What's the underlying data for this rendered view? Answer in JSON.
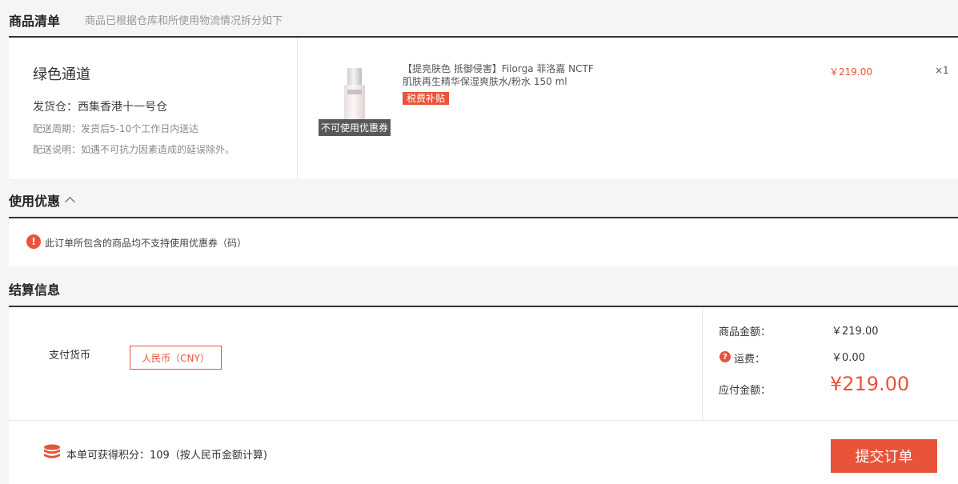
{
  "items_section": {
    "title": "商品清单",
    "subtitle": "商品已根据仓库和所使用物流情况拆分如下"
  },
  "shipment": {
    "channel": "绿色通道",
    "warehouse": "发货仓：西集香港十一号仓",
    "delivery_period": "配送周期：发货后5-10个工作日内送达",
    "delivery_note": "配送说明：如遇不可抗力因素造成的延误除外。"
  },
  "product": {
    "name_line1": "【提亮肤色 抵御侵害】Filorga 菲洛嘉 NCTF",
    "name_line2": "肌肤再生精华保湿爽肤水/粉水 150 ml",
    "tag": "税费补贴",
    "no_coupon_label": "不可使用优惠券",
    "price": "￥219.00",
    "quantity": "×1",
    "image_icon": "product-bottle-icon"
  },
  "coupon_section": {
    "title": "使用优惠",
    "toggle_icon": "chevron-up-icon",
    "warning_icon": "!",
    "notice": "此订单所包含的商品均不支持使用优惠券（码）"
  },
  "settlement_section": {
    "title": "结算信息",
    "currency_label": "支付货币",
    "currency_value": "人民币（CNY）",
    "goods_amount_label": "商品金额：",
    "goods_amount": "￥219.00",
    "shipping_icon": "?",
    "shipping_label": "运费：",
    "shipping_amount": "￥0.00",
    "payable_label": "应付金额：",
    "payable_amount": "¥219.00"
  },
  "footer": {
    "points_icon": "coins-stack-icon",
    "points_text": "本单可获得积分：109（按人民币金额计算)",
    "submit_label": "提交订单"
  },
  "colors": {
    "accent": "#e8533a",
    "text": "#333333",
    "muted": "#999999",
    "background": "#f5f5f5"
  }
}
